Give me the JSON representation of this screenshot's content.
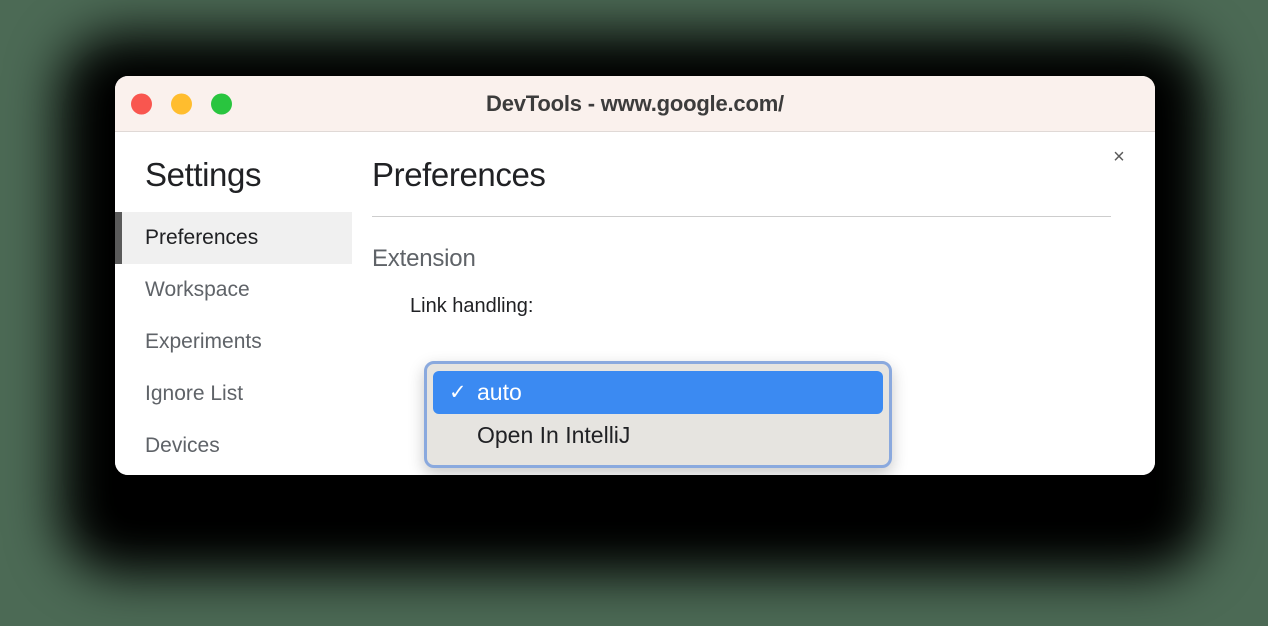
{
  "window": {
    "title": "DevTools - www.google.com/",
    "traffic_lights": [
      {
        "name": "close",
        "color": "#f9564f"
      },
      {
        "name": "minimize",
        "color": "#ffbd2e"
      },
      {
        "name": "zoom",
        "color": "#29c53f"
      }
    ],
    "close_icon": "×"
  },
  "sidebar": {
    "title": "Settings",
    "items": [
      {
        "label": "Preferences",
        "selected": true
      },
      {
        "label": "Workspace",
        "selected": false
      },
      {
        "label": "Experiments",
        "selected": false
      },
      {
        "label": "Ignore List",
        "selected": false
      },
      {
        "label": "Devices",
        "selected": false
      }
    ]
  },
  "main": {
    "title": "Preferences",
    "section_label": "Extension",
    "field_label": "Link handling:"
  },
  "dropdown": {
    "selected_value": "auto",
    "check_glyph": "✓",
    "options": [
      {
        "label": "auto",
        "selected": true
      },
      {
        "label": "Open In IntelliJ",
        "selected": false
      }
    ]
  },
  "colors": {
    "background": "#4c6a55",
    "titlebar": "#faf1ed",
    "accent_blue": "#3b8af2",
    "focus_ring": "#8aa9de",
    "menu_background": "#e6e4e0",
    "selected_item_background": "#f0f0f0",
    "selected_item_bar": "#5a5a5a"
  }
}
